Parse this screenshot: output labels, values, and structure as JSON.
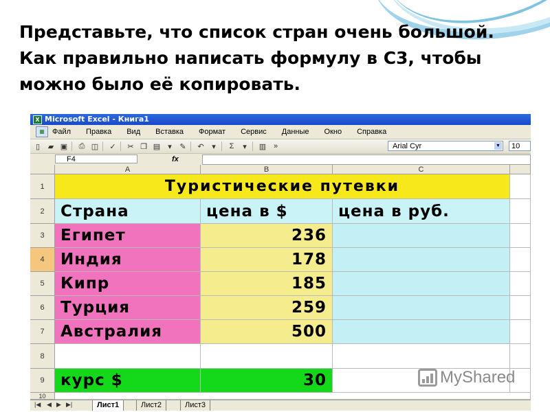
{
  "slide": {
    "title_lines": [
      "Представьте, что список стран очень большой.",
      "Как правильно написать формулу в С3, чтобы",
      "можно было её копировать."
    ]
  },
  "window": {
    "title": "Microsoft Excel - Книга1"
  },
  "menu": [
    "Файл",
    "Правка",
    "Вид",
    "Вставка",
    "Формат",
    "Сервис",
    "Данные",
    "Окно",
    "Справка"
  ],
  "toolbar": {
    "font": "Arial Cyr",
    "size": "10"
  },
  "formula_bar": {
    "name_box": "F4",
    "fx": "fx"
  },
  "columns": [
    "A",
    "B",
    "C"
  ],
  "rows": [
    "1",
    "2",
    "3",
    "4",
    "5",
    "6",
    "7",
    "8",
    "9",
    "10"
  ],
  "table": {
    "title": "Туристические путевки",
    "headers": [
      "Страна",
      "цена в $",
      "цена в руб."
    ],
    "data": [
      {
        "country": "Египет",
        "price": "236"
      },
      {
        "country": "Индия",
        "price": "178"
      },
      {
        "country": "Кипр",
        "price": "185"
      },
      {
        "country": "Турция",
        "price": "259"
      },
      {
        "country": "Австралия",
        "price": "500"
      }
    ],
    "rate_label": "курс $",
    "rate_value": "30"
  },
  "sheets": [
    "Лист1",
    "Лист2",
    "Лист3"
  ],
  "watermark": "MyShared",
  "colors": {
    "pink": "#f173bd",
    "yellow": "#f5ec8e",
    "cyan": "#c9f3f6",
    "gold": "#f7e81c",
    "green": "#14d91a",
    "titlebar": "#2e6ae0"
  }
}
